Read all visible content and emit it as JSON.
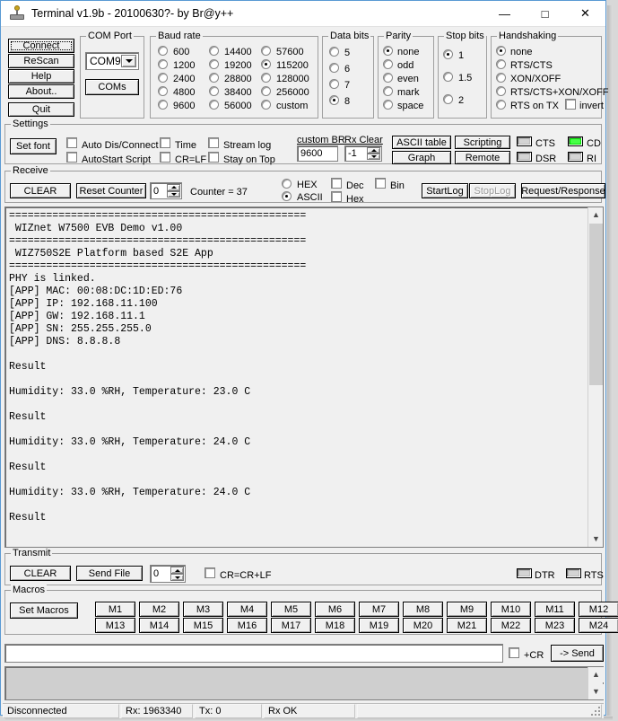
{
  "window": {
    "title": "Terminal v1.9b - 20100630?- by Br@y++",
    "icon": "terminal-icon",
    "minimize": "—",
    "maximize": "□",
    "close": "✕"
  },
  "actions": {
    "connect": "Connect",
    "rescan": "ReScan",
    "help": "Help",
    "about": "About..",
    "quit": "Quit"
  },
  "com_port": {
    "label": "COM Port",
    "selected": "COM9",
    "coms_button": "COMs"
  },
  "baud_rate": {
    "label": "Baud rate",
    "selected": "115200",
    "options": [
      "600",
      "14400",
      "57600",
      "1200",
      "19200",
      "115200",
      "2400",
      "28800",
      "128000",
      "4800",
      "38400",
      "256000",
      "9600",
      "56000",
      "custom"
    ]
  },
  "data_bits": {
    "label": "Data bits",
    "selected": "8",
    "options": [
      "5",
      "6",
      "7",
      "8"
    ]
  },
  "parity": {
    "label": "Parity",
    "selected": "none",
    "options": [
      "none",
      "odd",
      "even",
      "mark",
      "space"
    ]
  },
  "stop_bits": {
    "label": "Stop bits",
    "selected": "1",
    "options": [
      "1",
      "1.5",
      "2"
    ]
  },
  "handshaking": {
    "label": "Handshaking",
    "selected": "none",
    "options": [
      "none",
      "RTS/CTS",
      "XON/XOFF",
      "RTS/CTS+XON/XOFF",
      "RTS on TX"
    ],
    "invert_label": "invert",
    "invert_checked": false
  },
  "settings": {
    "label": "Settings",
    "set_font": "Set font",
    "checkboxes": [
      {
        "label": "Auto Dis/Connect",
        "checked": false
      },
      {
        "label": "AutoStart Script",
        "checked": false
      },
      {
        "label": "Time",
        "checked": false
      },
      {
        "label": "CR=LF",
        "checked": false
      },
      {
        "label": "Stream log",
        "checked": false
      },
      {
        "label": "Stay on Top",
        "checked": false
      }
    ],
    "custom_br_label": "custom BR",
    "custom_br_value": "9600",
    "rx_clear_label": "Rx Clear",
    "rx_clear_value": "-1",
    "ascii_table": "ASCII table",
    "scripting": "Scripting",
    "graph": "Graph",
    "remote": "Remote",
    "leds": [
      {
        "name": "CTS",
        "on": false
      },
      {
        "name": "CD",
        "on": true
      },
      {
        "name": "DSR",
        "on": false
      },
      {
        "name": "RI",
        "on": false
      }
    ]
  },
  "receive": {
    "label": "Receive",
    "clear": "CLEAR",
    "reset_counter": "Reset Counter",
    "counter_input": "0",
    "counter_text": "Counter = 37",
    "mode_selected": "ASCII",
    "modes": [
      "HEX",
      "ASCII"
    ],
    "checkboxes": [
      {
        "label": "Dec",
        "checked": false
      },
      {
        "label": "Hex",
        "checked": false
      },
      {
        "label": "Bin",
        "checked": false
      }
    ],
    "start_log": "StartLog",
    "stop_log": "StopLog",
    "request_response": "Request/Response"
  },
  "terminal": {
    "text": "================================================\n WIZnet W7500 EVB Demo v1.00\n================================================\n WIZ750S2E Platform based S2E App\n================================================\nPHY is linked.\n[APP] MAC: 00:08:DC:1D:ED:76\n[APP] IP: 192.168.11.100\n[APP] GW: 192.168.11.1\n[APP] SN: 255.255.255.0\n[APP] DNS: 8.8.8.8\n\nResult\n\nHumidity: 33.0 %RH, Temperature: 23.0 C\n\nResult\n\nHumidity: 33.0 %RH, Temperature: 24.0 C\n\nResult\n\nHumidity: 33.0 %RH, Temperature: 24.0 C\n\nResult"
  },
  "transmit": {
    "label": "Transmit",
    "clear": "CLEAR",
    "send_file": "Send File",
    "delay_value": "0",
    "cr_crlf_label": "CR=CR+LF",
    "cr_crlf_checked": false,
    "leds": [
      {
        "name": "DTR",
        "on": false
      },
      {
        "name": "RTS",
        "on": false
      }
    ]
  },
  "macros": {
    "label": "Macros",
    "set_macros": "Set Macros",
    "row1": [
      "M1",
      "M2",
      "M3",
      "M4",
      "M5",
      "M6",
      "M7",
      "M8",
      "M9",
      "M10",
      "M11",
      "M12"
    ],
    "row2": [
      "M13",
      "M14",
      "M15",
      "M16",
      "M17",
      "M18",
      "M19",
      "M20",
      "M21",
      "M22",
      "M23",
      "M24"
    ]
  },
  "send_bar": {
    "input_value": "",
    "cr_label": "+CR",
    "cr_checked": false,
    "send_button": "-> Send"
  },
  "status_bar": {
    "connection": "Disconnected",
    "rx": "Rx: 1963340",
    "tx": "Tx: 0",
    "rx_ok": "Rx OK",
    "extra": ""
  },
  "colors": {
    "accent": "#5a9ad4",
    "face": "#f0f0f0",
    "led_on": "#00e000"
  }
}
